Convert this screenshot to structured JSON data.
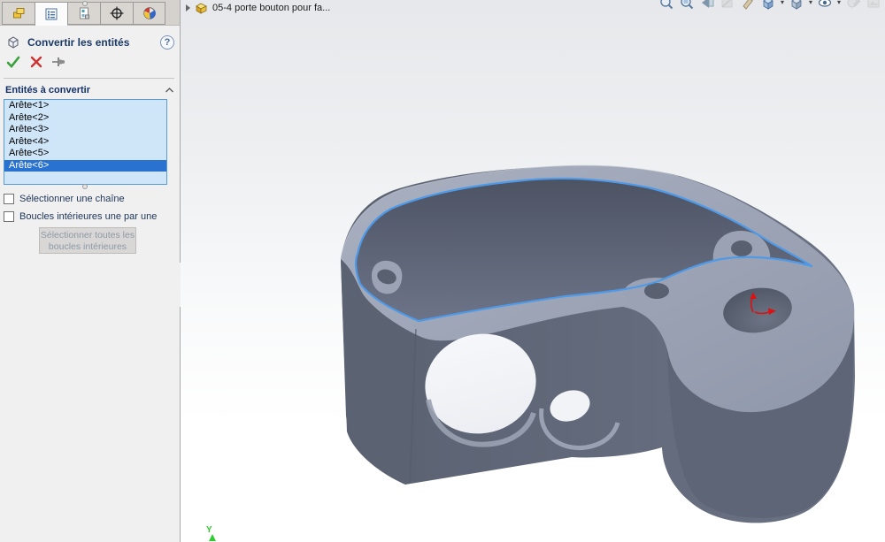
{
  "panel": {
    "tabs": [
      {
        "name": "feature-manager"
      },
      {
        "name": "property-manager",
        "active": true
      },
      {
        "name": "configuration-manager"
      },
      {
        "name": "dimxpert-manager"
      },
      {
        "name": "display-manager"
      }
    ],
    "title": "Convertir les entités",
    "help_glyph": "?",
    "actions": [
      {
        "name": "ok"
      },
      {
        "name": "cancel"
      },
      {
        "name": "keep-visible-pin"
      }
    ],
    "section": {
      "header": "Entités à convertir",
      "items": [
        "Arête<1>",
        "Arête<2>",
        "Arête<3>",
        "Arête<4>",
        "Arête<5>",
        "Arête<6>"
      ],
      "selected_item": "Arête<6>",
      "selected_index": 5
    },
    "checkboxes": [
      {
        "label": "Sélectionner une chaîne",
        "checked": false
      },
      {
        "label": "Boucles intérieures une par une",
        "checked": false
      }
    ],
    "select_loops_button": {
      "line1": "Sélectionner toutes les",
      "line2": "boucles intérieures",
      "disabled": true
    }
  },
  "viewport": {
    "feature_tree_document": "05-4 porte bouton pour fa...",
    "axis_triad_label": "Y",
    "headsup_icons": [
      "zoom-to-fit",
      "zoom-to-area",
      "previous-view",
      "section-view",
      "3d-drawing-view",
      "view-orientation",
      "display-style",
      "hide-show-items",
      "edit-appearance",
      "apply-scene"
    ]
  },
  "colors": {
    "selected_edge": "#4f9ae8",
    "list_selection": "#2a72cf",
    "list_background": "#cfe5f8",
    "origin_marker": "#dd1111",
    "axis_y": "#2ecc2e"
  }
}
